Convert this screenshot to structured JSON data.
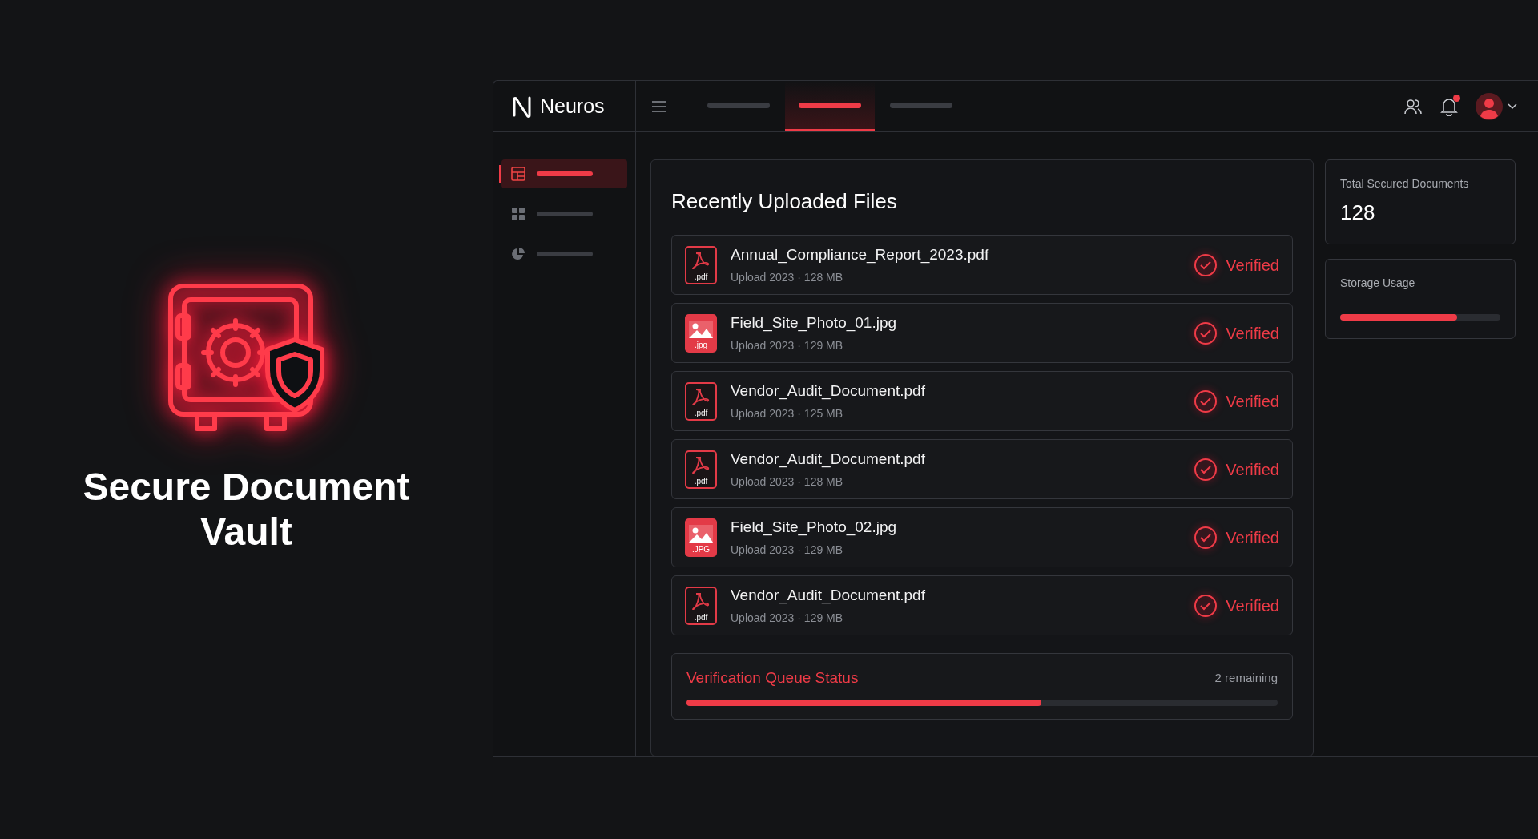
{
  "hero": {
    "title": "Secure Document Vault"
  },
  "app": {
    "brand": "Neuros",
    "nav_tabs": [
      {
        "selected": false
      },
      {
        "selected": true
      },
      {
        "selected": false
      }
    ],
    "header": {
      "notifications_unread": true
    },
    "sidebar": {
      "items": [
        {
          "kind": "layout",
          "selected": true
        },
        {
          "kind": "grid",
          "selected": false
        },
        {
          "kind": "pie",
          "selected": false
        }
      ]
    },
    "files_panel": {
      "title": "Recently Uploaded Files",
      "files": [
        {
          "kind": "pdf",
          "badge": ".pdf",
          "name": "Annual_Compliance_Report_2023.pdf",
          "meta": "Upload 2023 · 128 MB",
          "status": "Verified"
        },
        {
          "kind": "image",
          "badge": ".jpg",
          "name": "Field_Site_Photo_01.jpg",
          "meta": "Upload 2023 · 129 MB",
          "status": "Verified"
        },
        {
          "kind": "pdf",
          "badge": ".pdf",
          "name": "Vendor_Audit_Document.pdf",
          "meta": "Upload 2023 · 125 MB",
          "status": "Verified"
        },
        {
          "kind": "pdf",
          "badge": ".pdf",
          "name": "Vendor_Audit_Document.pdf",
          "meta": "Upload 2023 · 128 MB",
          "status": "Verified"
        },
        {
          "kind": "image",
          "badge": ".JPG",
          "name": "Field_Site_Photo_02.jpg",
          "meta": "Upload 2023 · 129 MB",
          "status": "Verified"
        },
        {
          "kind": "pdf",
          "badge": ".pdf",
          "name": "Vendor_Audit_Document.pdf",
          "meta": "Upload 2023 · 129 MB",
          "status": "Verified"
        }
      ],
      "queue": {
        "title": "Verification Queue Status",
        "remaining": "2 remaining",
        "level": 0.6
      }
    },
    "stats": {
      "total": {
        "label": "Total Secured Documents",
        "value": "128"
      },
      "storage": {
        "label": "Storage Usage",
        "level": 0.73
      }
    }
  }
}
